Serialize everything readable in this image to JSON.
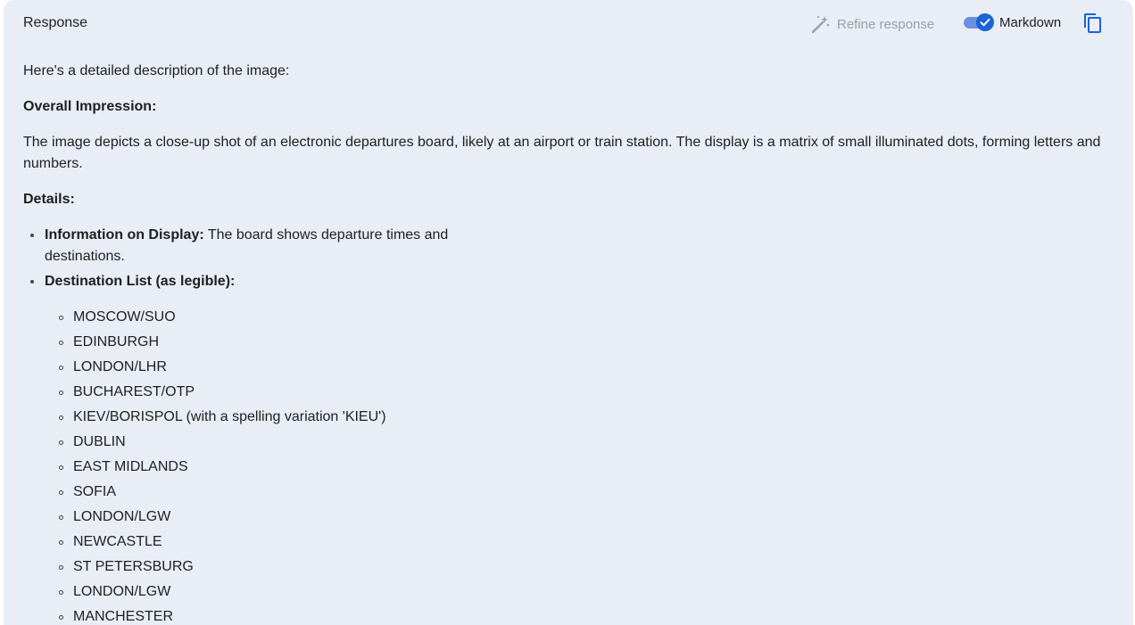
{
  "header": {
    "title": "Response",
    "refine_label": "Refine response",
    "markdown_label": "Markdown",
    "markdown_enabled": true,
    "accent_color": "#1b63d6"
  },
  "content": {
    "intro": "Here's a detailed description of the image:",
    "overall_heading": "Overall Impression:",
    "overall_text": "The image depicts a close-up shot of an electronic departures board, likely at an airport or train station. The display is a matrix of small illuminated dots, forming letters and numbers.",
    "details_heading": "Details:",
    "bullets": [
      {
        "label": "Information on Display:",
        "text": " The board shows departure times and destinations."
      },
      {
        "label": "Destination List (as legible):",
        "text": ""
      }
    ],
    "destinations": [
      "MOSCOW/SUO",
      "EDINBURGH",
      "LONDON/LHR",
      "BUCHAREST/OTP",
      "KIEV/BORISPOL (with a spelling variation 'KIEU')",
      "DUBLIN",
      "EAST MIDLANDS",
      "SOFIA",
      "LONDON/LGW",
      "NEWCASTLE",
      "ST PETERSBURG",
      "LONDON/LGW",
      "MANCHESTER"
    ]
  },
  "icons": {
    "refine": "magic-wand-icon",
    "toggle_check": "check-icon",
    "copy": "copy-icon"
  }
}
